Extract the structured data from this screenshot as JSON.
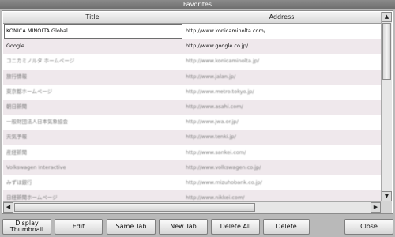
{
  "window": {
    "title": "Favorites"
  },
  "table": {
    "columns": [
      "Title",
      "Address"
    ],
    "rows": [
      {
        "title": "KONICA MINOLTA Global",
        "address": "http://www.konicaminolta.com/"
      },
      {
        "title": "Google",
        "address": "http://www.google.co.jp/"
      },
      {
        "title": "コニカミノルタ ホームページ",
        "address": "http://www.konicaminolta.jp/"
      },
      {
        "title": "旅行情報",
        "address": "http://www.jalan.jp/"
      },
      {
        "title": "東京都ホームページ",
        "address": "http://www.metro.tokyo.jp/"
      },
      {
        "title": "朝日新聞",
        "address": "http://www.asahi.com/"
      },
      {
        "title": "一般財団法人日本気象協会",
        "address": "http://www.jwa.or.jp/"
      },
      {
        "title": "天気予報",
        "address": "http://www.tenki.jp/"
      },
      {
        "title": "産経新聞",
        "address": "http://www.sankei.com/"
      },
      {
        "title": "Volkswagen Interactive",
        "address": "http://www.volkswagen.co.jp/"
      },
      {
        "title": "みずほ銀行",
        "address": "http://www.mizuhobank.co.jp/"
      },
      {
        "title": "日経新聞ホームページ",
        "address": "http://www.nikkei.com/"
      }
    ]
  },
  "scrollbar": {
    "up": "▲",
    "down": "▼",
    "left": "◀",
    "right": "▶"
  },
  "buttons": {
    "display_thumbnail_line1": "Display",
    "display_thumbnail_line2": "Thumbnail",
    "edit": "Edit",
    "same_tab": "Same Tab",
    "new_tab": "New Tab",
    "delete_all": "Delete All",
    "delete": "Delete",
    "close": "Close"
  }
}
